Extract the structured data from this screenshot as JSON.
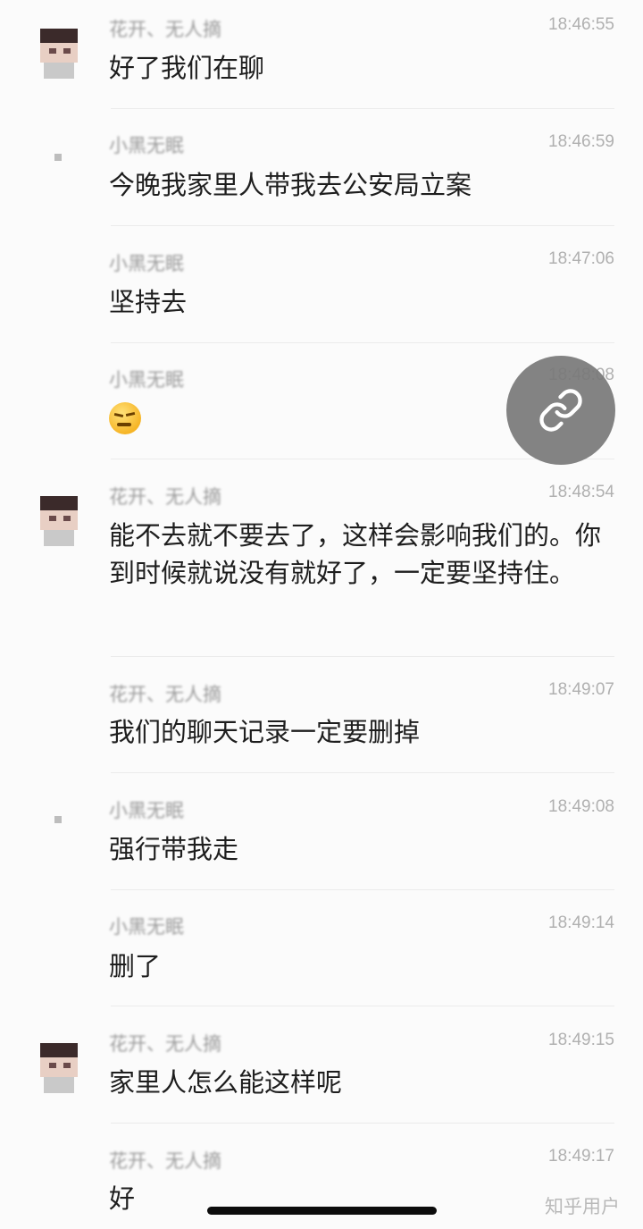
{
  "messages": [
    {
      "name": "花开、无人摘",
      "time": "18:46:55",
      "text": "好了我们在聊",
      "avatar": true
    },
    {
      "name": "小黑无眠",
      "time": "18:46:59",
      "text": "今晚我家里人带我去公安局立案",
      "avatar": false
    },
    {
      "name": "小黑无眠",
      "time": "18:47:06",
      "text": "坚持去",
      "avatar": false
    },
    {
      "name": "小黑无眠",
      "time": "18:48:08",
      "text": "",
      "emoji": "facepalm-emoji",
      "avatar": false
    },
    {
      "name": "花开、无人摘",
      "time": "18:48:54",
      "text": "能不去就不要去了，这样会影响我们的。你到时候就说没有就好了，一定要坚持住。",
      "avatar": true
    },
    {
      "name": "花开、无人摘",
      "time": "18:49:07",
      "text": "我们的聊天记录一定要删掉",
      "avatar": false
    },
    {
      "name": "小黑无眠",
      "time": "18:49:08",
      "text": "强行带我走",
      "avatar": false
    },
    {
      "name": "小黑无眠",
      "time": "18:49:14",
      "text": "删了",
      "avatar": false
    },
    {
      "name": "花开、无人摘",
      "time": "18:49:15",
      "text": "家里人怎么能这样呢",
      "avatar": true
    },
    {
      "name": "花开、无人摘",
      "time": "18:49:17",
      "text": "好",
      "avatar": false
    }
  ],
  "share_button": {
    "icon": "link-icon"
  },
  "watermark": "知乎用户",
  "colors": {
    "background": "#fbfbfb",
    "time": "#b0b0b0",
    "fab": "#787878"
  }
}
